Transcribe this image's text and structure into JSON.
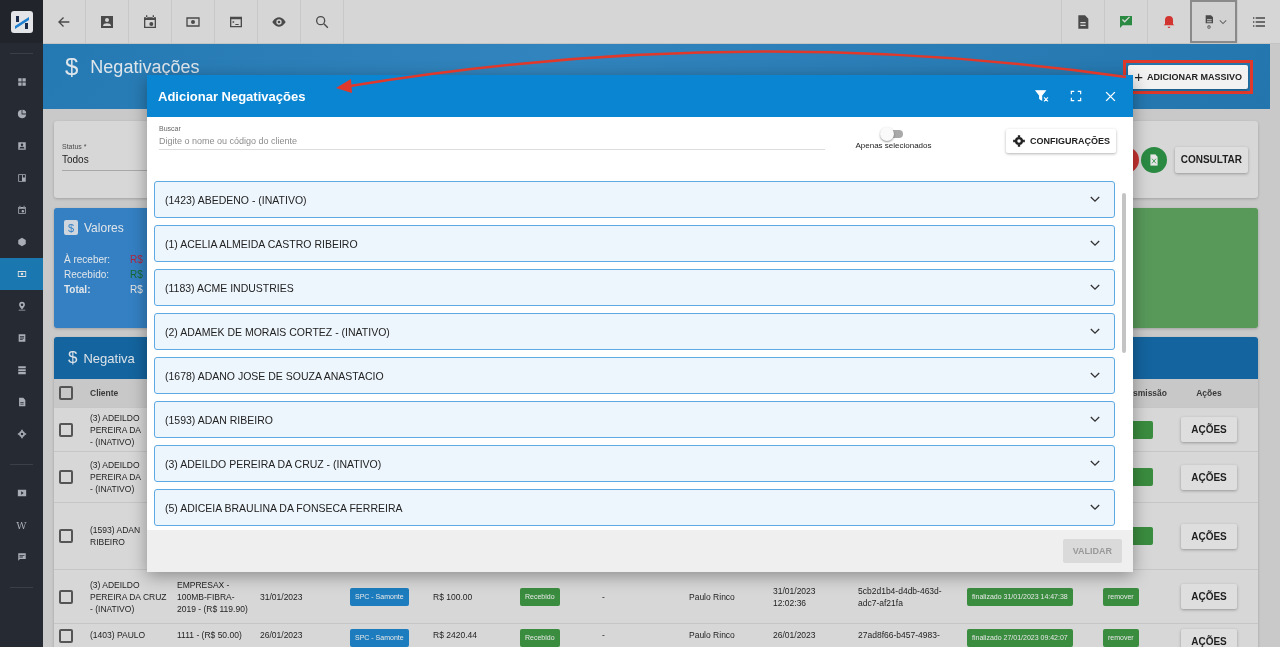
{
  "sidebar": {
    "items": [
      {
        "kind": "grid",
        "selected": false
      },
      {
        "kind": "chart",
        "selected": false
      },
      {
        "kind": "contact",
        "selected": false
      },
      {
        "kind": "board",
        "selected": false
      },
      {
        "kind": "calendar",
        "selected": false
      },
      {
        "kind": "box",
        "selected": false
      },
      {
        "kind": "money",
        "selected": true
      },
      {
        "kind": "pin",
        "selected": false
      },
      {
        "kind": "doc",
        "selected": false
      },
      {
        "kind": "server",
        "selected": false
      },
      {
        "kind": "file",
        "selected": false
      },
      {
        "kind": "gear",
        "selected": false
      },
      {
        "kind": "video",
        "selected": false
      },
      {
        "kind": "letter",
        "text": "W",
        "selected": false
      },
      {
        "kind": "chat",
        "selected": false
      }
    ]
  },
  "topbar": {
    "left_buttons": [
      {
        "kind": "back"
      },
      {
        "kind": "contact"
      },
      {
        "kind": "calendar"
      },
      {
        "kind": "money"
      },
      {
        "kind": "terminal"
      },
      {
        "kind": "eye"
      },
      {
        "kind": "search"
      }
    ],
    "right_buttons": [
      {
        "kind": "pdf",
        "selected": false
      },
      {
        "kind": "check",
        "selected": false
      },
      {
        "kind": "bell",
        "selected": false
      },
      {
        "kind": "report",
        "selected": true
      },
      {
        "kind": "list",
        "selected": false
      }
    ]
  },
  "page_header": {
    "icon": "$",
    "title": "Negativações",
    "action": "ADICIONAR MASSIVO",
    "action_icon": "+"
  },
  "filters": {
    "field": {
      "label": "Status *",
      "value": "Todos"
    },
    "button": "CONSULTAR"
  },
  "summary": {
    "icon": "$",
    "title": "Valores",
    "lines": [
      {
        "label": "À receber:",
        "value": "R$",
        "color": "#b3243e",
        "emphasis": false
      },
      {
        "label": "Recebido:",
        "value": "R$",
        "color": "#17692f",
        "emphasis": false
      },
      {
        "label": "Total:",
        "value": "R$",
        "color": "#e4e4e4",
        "emphasis": true
      }
    ]
  },
  "table": {
    "icon": "$",
    "title": "Negativa",
    "header_checked": false,
    "columns": [
      {
        "label": "Cliente"
      },
      {
        "label": "smissão"
      },
      {
        "label": "Ações"
      }
    ],
    "rows": [
      {
        "checked": false,
        "client_lines": [
          "(3) ADEILDO",
          "PEREIRA DA",
          "- (INATIVO)"
        ],
        "remove_tag": true,
        "action": "AÇÕES"
      },
      {
        "checked": false,
        "client_lines": [
          "(3) ADEILDO",
          "PEREIRA DA",
          "- (INATIVO)"
        ],
        "remove_tag": true,
        "action": "AÇÕES"
      },
      {
        "checked": false,
        "client_lines": [
          "(1593) ADAN",
          "RIBEIRO"
        ],
        "remove_tag": true,
        "action": "AÇÕES"
      },
      {
        "checked": false,
        "client_lines": [
          "(3) ADEILDO",
          "PEREIRA DA CRUZ",
          "- (INATIVO)"
        ],
        "plan": "EMPRESAX - 100MB-FIBRA-2019 - (R$ 119.90)",
        "date": "31/01/2023",
        "bureau": "SPC - Samonte",
        "value": "R$ 100.00",
        "status": "Recebido",
        "column_7": "-",
        "user": "Paulo Rinco",
        "sent_at": "31/01/2023 12:02:36",
        "protocol": "5cb2d1b4-d4db-463d-adc7-af21fa",
        "transmission": "finalizado 31/01/2023 14:47:38",
        "remove": "remover",
        "action": "AÇÕES"
      },
      {
        "checked": false,
        "client_lines": [
          "(1403) PAULO"
        ],
        "plan": "1111 - (R$ 50.00)",
        "date": "26/01/2023",
        "bureau": "SPC - Samonte",
        "value": "R$ 2420.44",
        "status": "Recebido",
        "column_7": "-",
        "user": "Paulo Rinco",
        "sent_at": "26/01/2023",
        "protocol": "27ad8f66-b457-4983-",
        "transmission": "finalizado 27/01/2023 09:42:07",
        "remove": "remover",
        "action": "AÇÕES"
      }
    ]
  },
  "modal": {
    "title": "Adicionar Negativações",
    "search": {
      "label": "Buscar",
      "placeholder": "Digite o nome ou código do cliente"
    },
    "toggle": {
      "label": "Apenas selecionados",
      "on": false
    },
    "settings_button": "CONFIGURAÇÕES",
    "clients": [
      {
        "name": "(1423) ABEDENO - (INATIVO)",
        "expanded": false
      },
      {
        "name": "(1) ACELIA ALMEIDA CASTRO RIBEIRO",
        "expanded": false
      },
      {
        "name": "(1183) ACME INDUSTRIES",
        "expanded": false
      },
      {
        "name": "(2) ADAMEK DE MORAIS CORTEZ - (INATIVO)",
        "expanded": false
      },
      {
        "name": "(1678) ADANO JOSE DE SOUZA ANASTACIO",
        "expanded": false
      },
      {
        "name": "(1593) ADAN RIBEIRO",
        "expanded": false
      },
      {
        "name": "(3) ADEILDO PEREIRA DA CRUZ - (INATIVO)",
        "expanded": false
      },
      {
        "name": "(5) ADICEIA BRAULINA DA FONSECA FERREIRA",
        "expanded": false
      }
    ],
    "validate_button": {
      "label": "VALIDAR",
      "disabled": true
    }
  }
}
